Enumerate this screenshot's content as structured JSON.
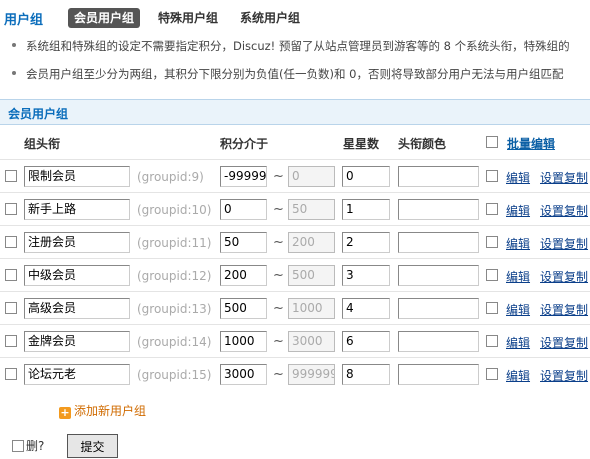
{
  "header": {
    "title": "用户组",
    "tabs": [
      {
        "label": "会员用户组",
        "active": true
      },
      {
        "label": "特殊用户组",
        "active": false
      },
      {
        "label": "系统用户组",
        "active": false
      }
    ]
  },
  "tips": [
    "系统组和特殊组的设定不需要指定积分，Discuz! 预留了从站点管理员到游客等的  8 个系统头衔，特殊组的",
    "会员用户组至少分为两组，其积分下限分别为负值(任一负数)和  0，否则将导致部分用户无法与用户组匹配"
  ],
  "group_section_title": "会员用户组",
  "columns": {
    "name": "组头衔",
    "credits": "积分介于",
    "stars": "星星数",
    "color": "头衔颜色",
    "bulk_edit": "批量编辑"
  },
  "rows": [
    {
      "name": "限制会员",
      "groupid": "(groupid:9)",
      "credit_low": "-99999",
      "credit_high": "0",
      "stars": "0",
      "color": "",
      "edit": "编辑",
      "settings": "设置复制"
    },
    {
      "name": "新手上路",
      "groupid": "(groupid:10)",
      "credit_low": "0",
      "credit_high": "50",
      "stars": "1",
      "color": "",
      "edit": "编辑",
      "settings": "设置复制"
    },
    {
      "name": "注册会员",
      "groupid": "(groupid:11)",
      "credit_low": "50",
      "credit_high": "200",
      "stars": "2",
      "color": "",
      "edit": "编辑",
      "settings": "设置复制"
    },
    {
      "name": "中级会员",
      "groupid": "(groupid:12)",
      "credit_low": "200",
      "credit_high": "500",
      "stars": "3",
      "color": "",
      "edit": "编辑",
      "settings": "设置复制"
    },
    {
      "name": "高级会员",
      "groupid": "(groupid:13)",
      "credit_low": "500",
      "credit_high": "1000",
      "stars": "4",
      "color": "",
      "edit": "编辑",
      "settings": "设置复制"
    },
    {
      "name": "金牌会员",
      "groupid": "(groupid:14)",
      "credit_low": "1000",
      "credit_high": "3000",
      "stars": "6",
      "color": "",
      "edit": "编辑",
      "settings": "设置复制"
    },
    {
      "name": "论坛元老",
      "groupid": "(groupid:15)",
      "credit_low": "3000",
      "credit_high": "999999",
      "stars": "8",
      "color": "",
      "edit": "编辑",
      "settings": "设置复制"
    }
  ],
  "add_group": "添加新用户组",
  "delete_label": "删?",
  "submit_label": "提交",
  "accent_color": "#0B6DBB",
  "add_icon": "plus-icon"
}
